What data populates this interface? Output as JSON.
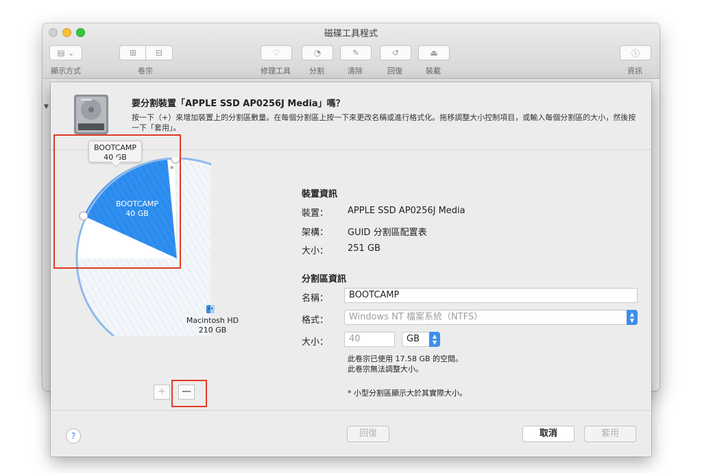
{
  "window": {
    "title": "磁碟工具程式"
  },
  "toolbar": {
    "view_label": "顯示方式",
    "volume_label": "卷宗",
    "first_aid_label": "修理工具",
    "partition_label": "分割",
    "erase_label": "清除",
    "restore_label": "回復",
    "mount_label": "裝載",
    "info_label": "資訊"
  },
  "sheet": {
    "title": "要分割裝置「APPLE SSD AP0256J Media」嗎？",
    "description": "按一下（+）來增加裝置上的分割區數量。在每個分割區上按一下來更改名稱或進行格式化。拖移調整大小控制項目，或輸入每個分割區的大小，然後按一下「套用」。"
  },
  "pie": {
    "tooltip_name": "BOOTCAMP",
    "tooltip_size": "40 GB",
    "small_marker": "*",
    "partitions": [
      {
        "name": "BOOTCAMP",
        "size": "40 GB",
        "value_gb": 40,
        "color": "#2d8cf0",
        "selected": true
      },
      {
        "name": "Macintosh HD",
        "size": "210 GB",
        "value_gb": 210,
        "color": "#e6eef8",
        "selected": false
      }
    ],
    "add_label": "+",
    "remove_label": "—"
  },
  "device_info": {
    "section_title": "裝置資訊",
    "device_label": "裝置：",
    "device_value": "APPLE SSD AP0256J Media",
    "scheme_label": "架構：",
    "scheme_value": "GUID 分割區配置表",
    "size_label": "大小：",
    "size_value": "251 GB"
  },
  "partition_info": {
    "section_title": "分割區資訊",
    "name_label": "名稱：",
    "name_value": "BOOTCAMP",
    "format_label": "格式：",
    "format_value": "Windows NT 檔案系統（NTFS）",
    "size_label": "大小：",
    "size_value": "40",
    "unit_value": "GB",
    "note_used": "此卷宗已使用 17.58 GB 的空間。",
    "note_no_resize": "此卷宗無法調整大小。",
    "note_small": "* 小型分割區顯示大於其實際大小。"
  },
  "footer": {
    "help_label": "?",
    "revert_label": "回復",
    "cancel_label": "取消",
    "apply_label": "套用"
  },
  "colors": {
    "accent": "#2d8cf0",
    "highlight": "#e03a24"
  }
}
